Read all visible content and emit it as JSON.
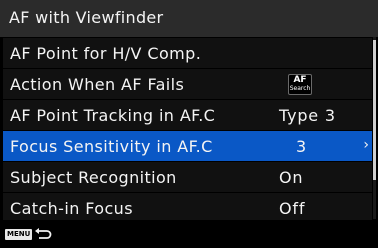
{
  "header": {
    "title": "AF with Viewfinder"
  },
  "menu": {
    "items": [
      {
        "label": "AF Point for H/V Comp.",
        "value": ""
      },
      {
        "label": "Action When AF Fails",
        "value": "",
        "value_icon": "af-search-icon",
        "badge_top": "AF",
        "badge_bottom": "Search"
      },
      {
        "label": "AF Point Tracking in AF.C",
        "value": "Type 3"
      },
      {
        "label": "Focus Sensitivity in AF.C",
        "value": "3",
        "selected": true
      },
      {
        "label": "Subject Recognition",
        "value": "On"
      },
      {
        "label": "Catch-in Focus",
        "value": "Off"
      }
    ],
    "selected_chevron": "›"
  },
  "footer": {
    "menu_key": "MENU",
    "back_icon": "back-arrow-icon"
  },
  "colors": {
    "selection": "#0a58c6",
    "title_bar": "#2b2b2b",
    "row_background": "#111111",
    "background": "#000000",
    "text": "#f4f4f4"
  }
}
